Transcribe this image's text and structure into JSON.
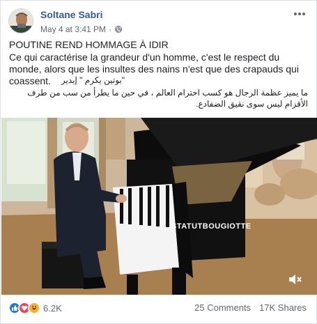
{
  "post": {
    "author": "Soltane Sabri",
    "timestamp": "May 4 at 3:41 PM",
    "separator": "·",
    "privacy_icon": "globe-icon",
    "more_icon": "more-options-icon",
    "title": "POUTINE REND HOMMAGE À IDIR",
    "body_fr": "Ce qui caractérise la grandeur d'un homme, c'est le respect du monde, alors que les insultes des nains n'est que des crapauds qui coassent.",
    "body_ar_1": "\"بوتين يكرم \" إيدير",
    "body_ar_2": "ما يميز عظمة الرجال هو كسب احترام العالم ، في حين ما يطرأ من سب من طرف الأقزام ليس سوى نقيق الضفادع."
  },
  "video": {
    "piano_brand": "STATUTBOUGIOTTE",
    "volume_icon": "volume-muted-icon"
  },
  "footer": {
    "reaction_icons": [
      "like-icon",
      "love-icon",
      "haha-icon"
    ],
    "reaction_count": "6.2K",
    "comments": "25 Comments",
    "shares": "17K Shares"
  },
  "colors": {
    "link": "#385898",
    "secondary_text": "#606770",
    "like": "#1877f2",
    "love": "#f33e58",
    "haha": "#f7b125"
  }
}
